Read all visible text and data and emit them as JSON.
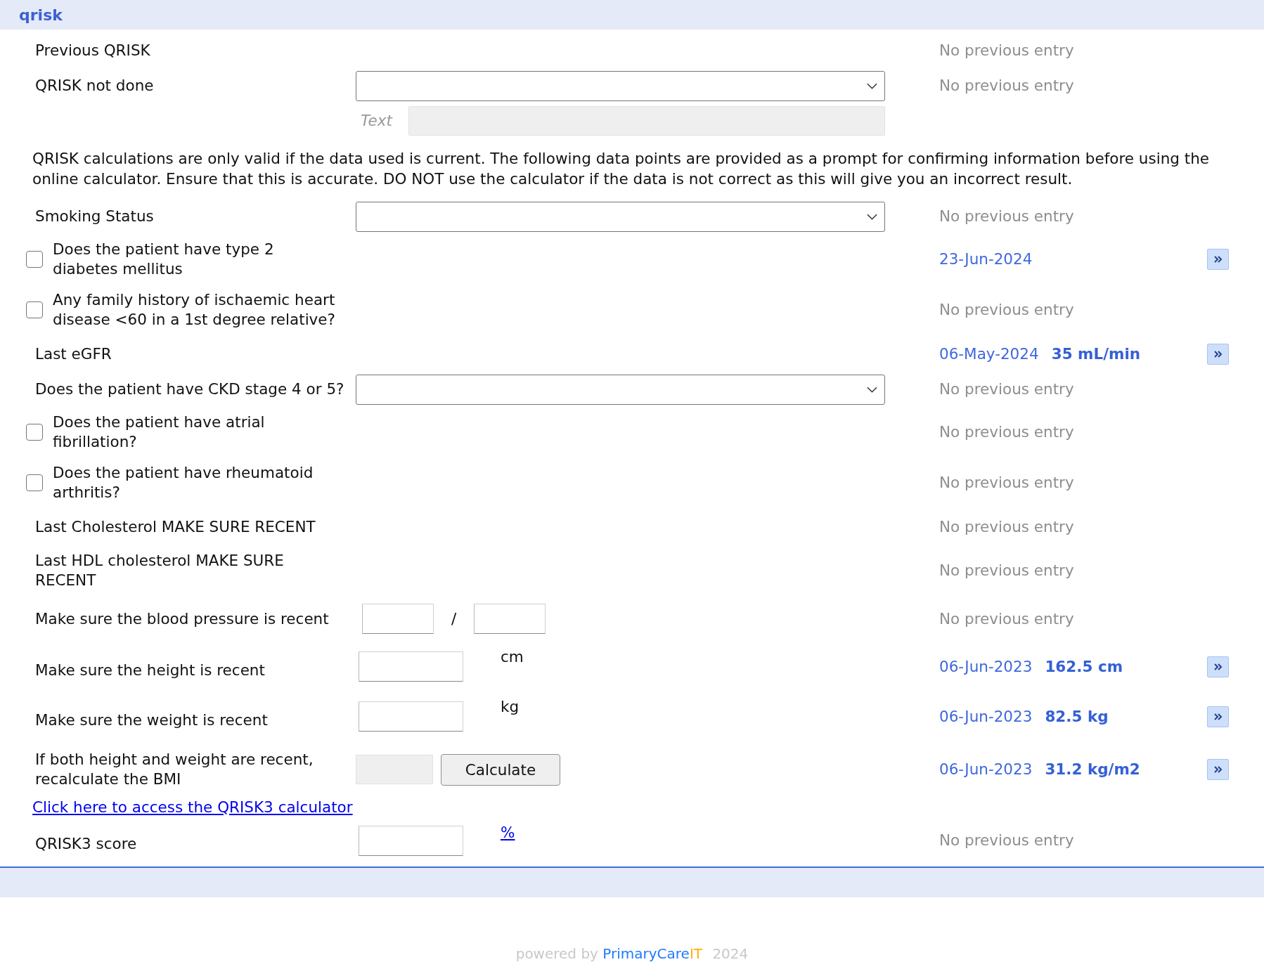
{
  "header": {
    "title": "qrisk"
  },
  "rows": [
    {
      "kind": "info",
      "label": "Previous QRISK",
      "previous": {
        "kind": "none",
        "text": "No previous entry"
      }
    },
    {
      "kind": "select",
      "label": "QRISK not done",
      "previous": {
        "kind": "none",
        "text": "No previous entry"
      }
    },
    {
      "kind": "note",
      "label": "Text",
      "disabled": true
    },
    {
      "kind": "paragraph",
      "text": "QRISK calculations are only valid if the data used is current. The following data points are provided as a prompt for confirming information before using the online calculator. Ensure that this is accurate. DO NOT use the calculator if the data is not correct as this will give you an incorrect result."
    },
    {
      "kind": "select",
      "label": "Smoking Status",
      "previous": {
        "kind": "none",
        "text": "No previous entry"
      }
    },
    {
      "kind": "checkbox",
      "label": "Does the patient have type 2 diabetes mellitus",
      "checked": false,
      "previous": {
        "kind": "reading",
        "date": "23-Jun-2024",
        "copy_button": true
      }
    },
    {
      "kind": "checkbox",
      "label": "Any family history of ischaemic heart disease <60 in a 1st degree relative?",
      "checked": false,
      "previous": {
        "kind": "none",
        "text": "No previous entry"
      }
    },
    {
      "kind": "info",
      "label": "Last eGFR",
      "previous": {
        "kind": "reading",
        "date": "06-May-2024",
        "value": "35 mL/min",
        "copy_button": true
      }
    },
    {
      "kind": "select",
      "label": "Does the patient have CKD stage 4 or 5?",
      "previous": {
        "kind": "none",
        "text": "No previous entry"
      }
    },
    {
      "kind": "checkbox",
      "label": "Does the patient have atrial fibrillation?",
      "checked": false,
      "previous": {
        "kind": "none",
        "text": "No previous entry"
      }
    },
    {
      "kind": "checkbox",
      "label": "Does the patient have rheumatoid arthritis?",
      "checked": false,
      "previous": {
        "kind": "none",
        "text": "No previous entry"
      }
    },
    {
      "kind": "info",
      "label": "Last Cholesterol MAKE SURE RECENT",
      "previous": {
        "kind": "none",
        "text": "No previous entry"
      }
    },
    {
      "kind": "info",
      "label": "Last HDL cholesterol MAKE SURE RECENT",
      "previous": {
        "kind": "none",
        "text": "No previous entry"
      }
    },
    {
      "kind": "bp",
      "label": "Make sure the blood pressure is recent",
      "separator": "/",
      "previous": {
        "kind": "none",
        "text": "No previous entry"
      }
    },
    {
      "kind": "measure",
      "label": "Make sure the height is recent",
      "unit": "cm",
      "previous": {
        "kind": "reading",
        "date": "06-Jun-2023",
        "value": "162.5 cm",
        "copy_button": true
      }
    },
    {
      "kind": "measure",
      "label": "Make sure the weight is recent",
      "unit": "kg",
      "previous": {
        "kind": "reading",
        "date": "06-Jun-2023",
        "value": "82.5 kg",
        "copy_button": true
      }
    },
    {
      "kind": "bmi",
      "label": "If both height and weight are recent, recalculate the BMI",
      "disabled": true,
      "button": "Calculate",
      "previous": {
        "kind": "reading",
        "date": "06-Jun-2023",
        "value": "31.2 kg/m2",
        "copy_button": true
      }
    },
    {
      "kind": "link",
      "text": "Click here to access the QRISK3 calculator"
    },
    {
      "kind": "score",
      "label": "QRISK3 score",
      "unit": "%",
      "previous": {
        "kind": "none",
        "text": "No previous entry"
      }
    }
  ],
  "footer": {
    "prefix": "powered by",
    "brand": "PrimaryCare",
    "brand_suffix": "IT",
    "year": "2024"
  }
}
